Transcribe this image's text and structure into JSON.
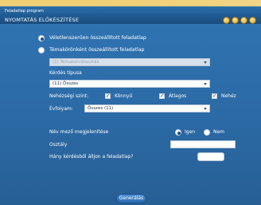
{
  "app": {
    "title": "Feladatlap program"
  },
  "window": {
    "title": "NYOMTATÁS ELŐKÉSZÍTÉSE"
  },
  "options": {
    "random": {
      "label": "Véletlenszerűen összeállított feladatlap",
      "selected": true
    },
    "themed": {
      "label": "Témakörönként összeállított feladatlap",
      "selected": false
    },
    "topic_dropdown": {
      "value": "(1) Témakörválasztás",
      "disabled": true
    }
  },
  "question_type": {
    "label": "Kérdés típusa",
    "value": "(11) Összes"
  },
  "difficulty": {
    "label": "Nehézségi szint:",
    "items": [
      {
        "label": "Könnyű",
        "checked": true
      },
      {
        "label": "Átlagos",
        "checked": true
      },
      {
        "label": "Nehéz",
        "checked": true
      }
    ]
  },
  "grade": {
    "label": "Évfolyam:",
    "value": "Összes (11)"
  },
  "name_field": {
    "label": "Név mező megjelenítése",
    "yes_label": "Igen",
    "no_label": "Nem",
    "selected": "Igen"
  },
  "class_field": {
    "label": "Osztály",
    "value": ""
  },
  "question_count": {
    "label": "Hány kérdésből álljon a feladatlap?",
    "value": ""
  },
  "actions": {
    "generate_label": "Generálás"
  },
  "colors": {
    "panel_blue": "#2f73b1",
    "titlebar_blue": "#1f5a90",
    "background_gold": "#f0cf76"
  }
}
